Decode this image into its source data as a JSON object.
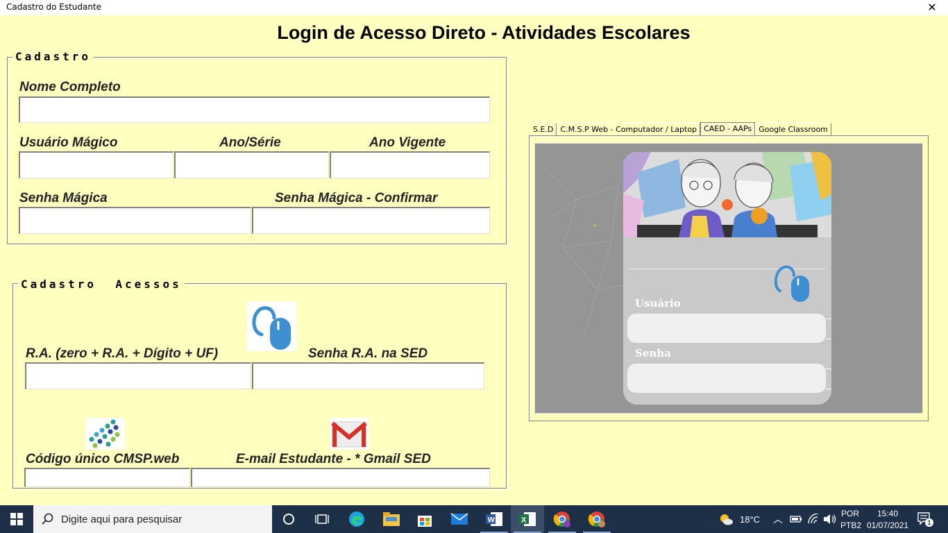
{
  "window": {
    "title": "Cadastro do Estudante",
    "close_glyph": "✕"
  },
  "heading": "Login de Acesso Direto - Atividades Escolares",
  "cadastro": {
    "legend": "Cadastro",
    "nome_label": "Nome Completo",
    "usuario_label": "Usuário Mágico",
    "ano_serie_label": "Ano/Série",
    "ano_vigente_label": "Ano Vigente",
    "senha_label": "Senha Mágica",
    "senha_confirmar_label": "Senha Mágica - Confirmar"
  },
  "acessos": {
    "legend": "Cadastro  Acessos",
    "ra_label": "R.A. (zero + R.A. + Dígito + UF)",
    "senha_ra_label": "Senha R.A. na SED",
    "codigo_label": "Código único CMSP.web",
    "email_label": "E-mail Estudante - * Gmail SED"
  },
  "tabs": [
    {
      "label": "S.E.D"
    },
    {
      "label": "C.M.S.P Web  - Computador / Laptop"
    },
    {
      "label": "CAED - AAPs"
    },
    {
      "label": "Google Classroom"
    }
  ],
  "login_card": {
    "usuario_label": "Usuário",
    "senha_label": "Senha"
  },
  "icons": {
    "mouse": "mouse-icon",
    "cmsp": "cmsp-logo-icon",
    "gmail": "gmail-icon"
  },
  "colors": {
    "background": "#FFFFC0",
    "taskbar": "#1e2f48",
    "mouse_blue": "#3d8fd1"
  },
  "taskbar": {
    "search_placeholder": "Digite aqui para pesquisar",
    "weather": "18°C",
    "lang1": "POR",
    "lang2": "PTB2",
    "time": "15:40",
    "date": "01/07/2021",
    "notifications": "1"
  }
}
